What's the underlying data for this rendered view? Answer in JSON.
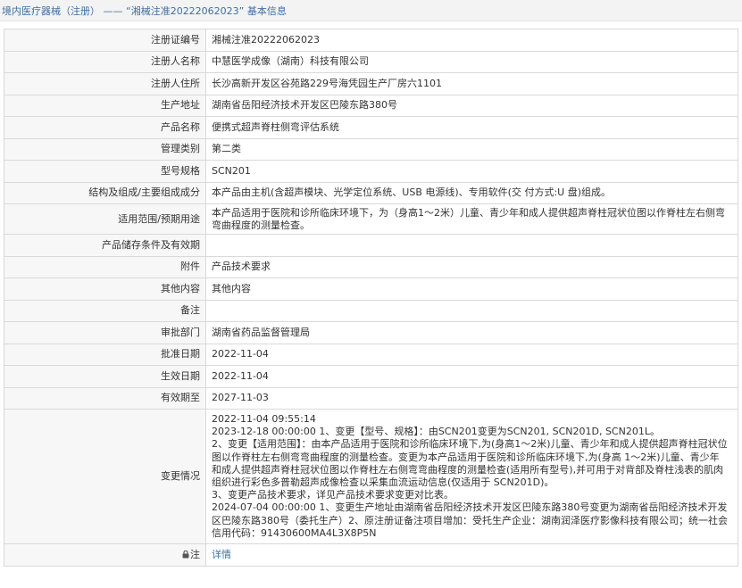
{
  "header": {
    "breadcrumb_title": "境内医疗器械（注册） —— “湘械注准20222062023” 基本信息"
  },
  "rows": [
    {
      "label": "注册证编号",
      "value": "湘械注准20222062023"
    },
    {
      "label": "注册人名称",
      "value": "中慧医学成像（湖南）科技有限公司"
    },
    {
      "label": "注册人住所",
      "value": "长沙高新开发区谷苑路229号海凭园生产厂房六1101"
    },
    {
      "label": "生产地址",
      "value": "湖南省岳阳经济技术开发区巴陵东路380号"
    },
    {
      "label": "产品名称",
      "value": "便携式超声脊柱侧弯评估系统"
    },
    {
      "label": "管理类别",
      "value": "第二类"
    },
    {
      "label": "型号规格",
      "value": "SCN201"
    },
    {
      "label": "结构及组成/主要组成成分",
      "value": "本产品由主机(含超声模块、光学定位系统、USB 电源线)、专用软件(交 付方式:U 盘)组成。"
    },
    {
      "label": "适用范围/预期用途",
      "value": "本产品适用于医院和诊所临床环境下，为（身高1～2米）儿童、青少年和成人提供超声脊柱冠状位图以作脊柱左右侧弯弯曲程度的测量检查。"
    },
    {
      "label": "产品储存条件及有效期",
      "value": ""
    },
    {
      "label": "附件",
      "value": "产品技术要求"
    },
    {
      "label": "其他内容",
      "value": "其他内容"
    },
    {
      "label": "备注",
      "value": ""
    },
    {
      "label": "审批部门",
      "value": "湖南省药品监督管理局"
    },
    {
      "label": "批准日期",
      "value": "2022-11-04"
    },
    {
      "label": "生效日期",
      "value": "2022-11-04"
    },
    {
      "label": "有效期至",
      "value": "2027-11-03"
    }
  ],
  "changes": {
    "label": "变更情况",
    "lines": [
      "2022-11-04 09:55:14",
      "2023-12-18 00:00:00 1、变更【型号、规格】：由SCN201变更为SCN201, SCN201D, SCN201L。",
      "2、变更【适用范围】：由本产品适用于医院和诊所临床环境下,为(身高1～2米)儿童、青少年和成人提供超声脊柱冠状位图以作脊柱左右侧弯弯曲程度的测量检查。变更为本产品适用于医院和诊所临床环境下,为(身高 1～2米)儿童、青少年和成人提供超声脊柱冠状位图以作脊柱左右侧弯弯曲程度的测量检查(适用所有型号),并可用于对背部及脊柱浅表的肌肉组织进行彩色多普勒超声成像检查以采集血流运动信息(仅适用于 SCN201D)。",
      "3、变更产品技术要求，详见产品技术要求变更对比表。",
      "2024-07-04 00:00:00 1、变更生产地址由湖南省岳阳经济技术开发区巴陵东路380号变更为湖南省岳阳经济技术开发区巴陵东路380号（委托生产）2、原注册证备注项目增加：受托生产企业：湖南润泽医疗影像科技有限公司；统一社会信用代码：91430600MA4L3X8P5N"
    ]
  },
  "detail": {
    "label": "注",
    "link_text": "详情"
  },
  "colors": {
    "header_bg": "#f3f3f3",
    "link": "#3f6fa0",
    "label_bg": "#f7f7f7",
    "border": "#d9d9d9"
  }
}
